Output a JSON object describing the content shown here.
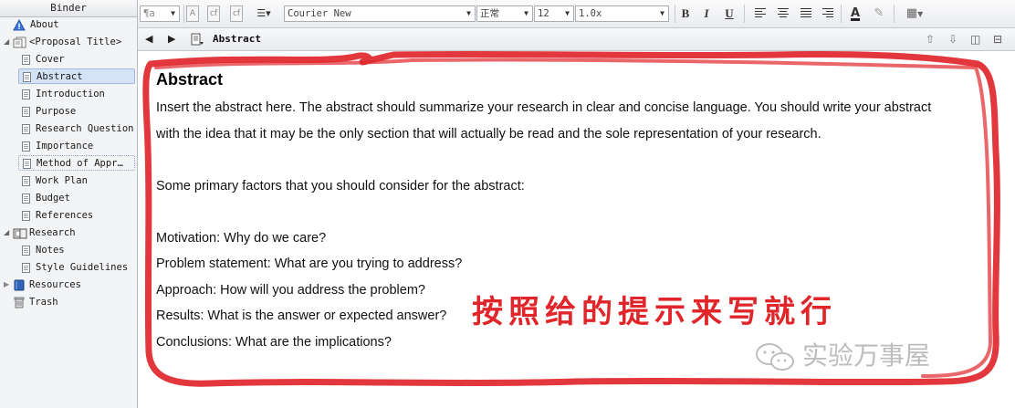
{
  "binder": {
    "title": "Binder",
    "items": [
      {
        "label": "About"
      },
      {
        "label": "<Proposal Title>"
      },
      {
        "label": "Cover"
      },
      {
        "label": "Abstract"
      },
      {
        "label": "Introduction"
      },
      {
        "label": "Purpose"
      },
      {
        "label": "Research Question"
      },
      {
        "label": "Importance"
      },
      {
        "label": "Method of Appr…"
      },
      {
        "label": "Work Plan"
      },
      {
        "label": "Budget"
      },
      {
        "label": "References"
      },
      {
        "label": "Research"
      },
      {
        "label": "Notes"
      },
      {
        "label": "Style Guidelines"
      },
      {
        "label": "Resources"
      },
      {
        "label": "Trash"
      }
    ]
  },
  "toolbar": {
    "style_value": "¶a",
    "font_value": "Courier New",
    "format_value": "正常",
    "size_value": "12",
    "spacing_value": "1.0x",
    "bold": "B",
    "italic": "I",
    "underline": "U"
  },
  "header": {
    "title": "Abstract"
  },
  "document": {
    "title": "Abstract",
    "lines": [
      "Insert the abstract here. The abstract should summarize your research in clear and concise language. You should write your abstract",
      "with the idea that it may be the only section that will actually be read and the sole representation of your research.",
      "Some primary factors that you should consider for the abstract:",
      "Motivation: Why do we care?",
      "Problem statement: What are you trying to address?",
      "Approach: How will you address the problem?",
      "Results: What is the answer or expected answer?",
      "Conclusions: What are the implications?"
    ]
  },
  "annotation": "按照给的提示来写就行",
  "watermark": "实验万事屋",
  "colors": {
    "annotation_red": "#e0262b",
    "selection": "#d5e3f7"
  }
}
